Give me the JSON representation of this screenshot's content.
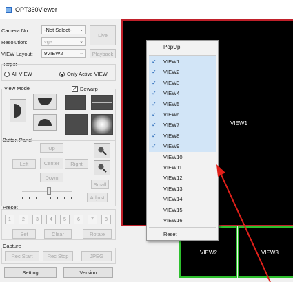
{
  "window": {
    "title": "OPT360Viewer"
  },
  "camera": {
    "label": "Camera No.:",
    "value": "-Not Select-"
  },
  "resolution": {
    "label": "Resolution:",
    "value": "vga"
  },
  "view_layout": {
    "label": "VIEW Layout:",
    "value": "9VIEW2"
  },
  "buttons": {
    "live": "Live",
    "playback": "Playback"
  },
  "target": {
    "title": "Target",
    "all_view": "All VIEW",
    "only_active": "Only Active VIEW",
    "selected": "only_active"
  },
  "view_mode": {
    "title": "View Mode",
    "dewarp_label": "Dewarp",
    "dewarp_checked": true
  },
  "button_panel": {
    "title": "Button Panel",
    "up": "Up",
    "left": "Left",
    "center": "Center",
    "right": "Right",
    "down": "Down",
    "small": "Small",
    "adjust": "Adjust"
  },
  "preset": {
    "title": "Preset",
    "slots": [
      "1",
      "2",
      "3",
      "4",
      "5",
      "6",
      "7",
      "8"
    ],
    "set": "Set",
    "clear": "Clear",
    "rotate": "Rotate"
  },
  "capture": {
    "title": "Capture",
    "rec_start": "Rec Start",
    "rec_stop": "Rec Stop",
    "jpeg": "JPEG"
  },
  "bottom": {
    "setting": "Setting",
    "version": "Version"
  },
  "views": {
    "view1": "VIEW1",
    "view2": "VIEW2",
    "view3": "VIEW3"
  },
  "popup": {
    "title": "PopUp",
    "items": [
      {
        "label": "VIEW1",
        "checked": true
      },
      {
        "label": "VIEW2",
        "checked": true
      },
      {
        "label": "VIEW3",
        "checked": true
      },
      {
        "label": "VIEW4",
        "checked": true
      },
      {
        "label": "VIEW5",
        "checked": true
      },
      {
        "label": "VIEW6",
        "checked": true
      },
      {
        "label": "VIEW7",
        "checked": true
      },
      {
        "label": "VIEW8",
        "checked": true
      },
      {
        "label": "VIEW9",
        "checked": true
      },
      {
        "label": "VIEW10",
        "checked": false
      },
      {
        "label": "VIEW11",
        "checked": false
      },
      {
        "label": "VIEW12",
        "checked": false
      },
      {
        "label": "VIEW13",
        "checked": false
      },
      {
        "label": "VIEW14",
        "checked": false
      },
      {
        "label": "VIEW15",
        "checked": false
      },
      {
        "label": "VIEW16",
        "checked": false
      }
    ],
    "reset": "Reset"
  },
  "colors": {
    "active_border": "#c0202a",
    "view_border": "#2ec02e",
    "annotation_arrow": "#e0201a",
    "menu_highlight": "#d2e5f7"
  }
}
